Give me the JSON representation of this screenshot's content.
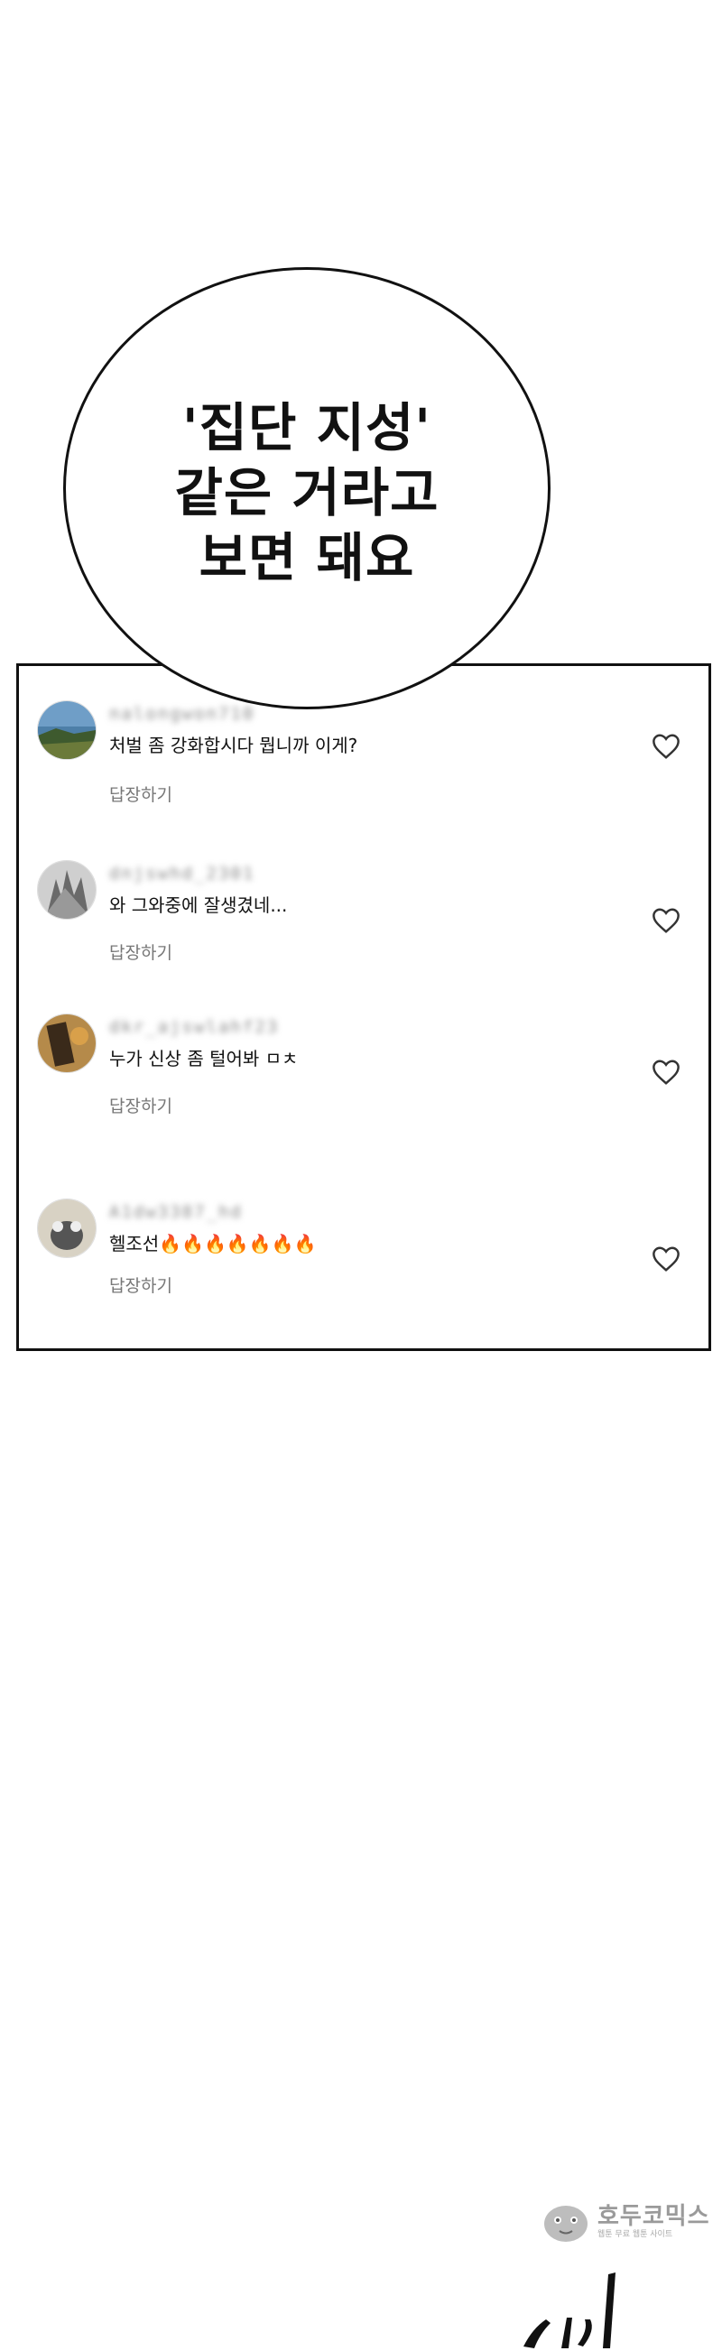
{
  "speech_bubble": {
    "lines": [
      "'집단 지성'",
      "같은 거라고",
      "보면 돼요"
    ]
  },
  "comments": [
    {
      "username": "nalongwon710",
      "text": "처벌 좀 강화합시다 뭡니까 이게?",
      "reply_label": "답장하기",
      "avatar_icon": "avatar-landscape-icon",
      "like_icon": "heart-icon"
    },
    {
      "username": "dnjswhd_2301",
      "text": "와 그와중에 잘생겼네...",
      "reply_label": "답장하기",
      "avatar_icon": "avatar-grayscale-tree-icon",
      "like_icon": "heart-icon"
    },
    {
      "username": "dkr_ajswlahf23",
      "text": "누가 신상 좀 털어봐 ㅁㅊ",
      "reply_label": "답장하기",
      "avatar_icon": "avatar-brown-icon",
      "like_icon": "heart-icon"
    },
    {
      "username": "A1dw3387_hd",
      "text": "헬조선🔥🔥🔥🔥🔥🔥🔥",
      "reply_label": "답장하기",
      "avatar_icon": "avatar-cat-icon",
      "like_icon": "heart-icon"
    }
  ],
  "watermark": {
    "title": "호두코믹스",
    "subtitle": "웹툰 무료 웹툰 사이트"
  },
  "colors": {
    "border": "#111111",
    "reply_text": "#777777",
    "watermark": "#9a9a9a"
  }
}
